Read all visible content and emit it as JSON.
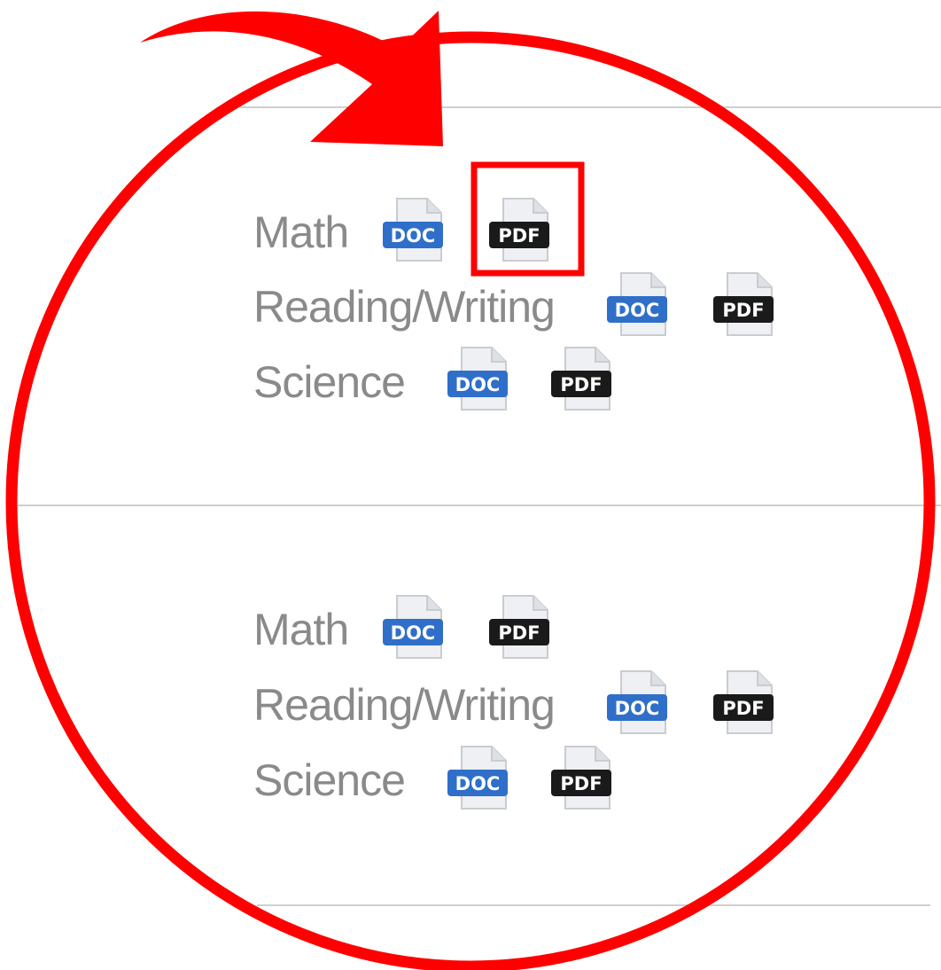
{
  "sections": [
    {
      "subjects": [
        {
          "label": "Math",
          "doc_icon": "doc-file-icon",
          "pdf_icon": "pdf-file-icon"
        },
        {
          "label": "Reading/Writing",
          "doc_icon": "doc-file-icon",
          "pdf_icon": "pdf-file-icon"
        },
        {
          "label": "Science",
          "doc_icon": "doc-file-icon",
          "pdf_icon": "pdf-file-icon"
        }
      ]
    },
    {
      "subjects": [
        {
          "label": "Math",
          "doc_icon": "doc-file-icon",
          "pdf_icon": "pdf-file-icon"
        },
        {
          "label": "Reading/Writing",
          "doc_icon": "doc-file-icon",
          "pdf_icon": "pdf-file-icon"
        },
        {
          "label": "Science",
          "doc_icon": "doc-file-icon",
          "pdf_icon": "pdf-file-icon"
        }
      ]
    }
  ],
  "badges": {
    "doc": "DOC",
    "pdf": "PDF"
  },
  "colors": {
    "text": "#8a8a8a",
    "divider": "#cfcfcf",
    "doc_badge": "#2f6fc9",
    "pdf_badge": "#1a1a1a",
    "annotation": "#ff0000"
  },
  "annotation": {
    "circle_icon": "red-circle-highlight",
    "arrow_icon": "red-curved-arrow-icon",
    "box_icon": "red-highlight-box"
  }
}
